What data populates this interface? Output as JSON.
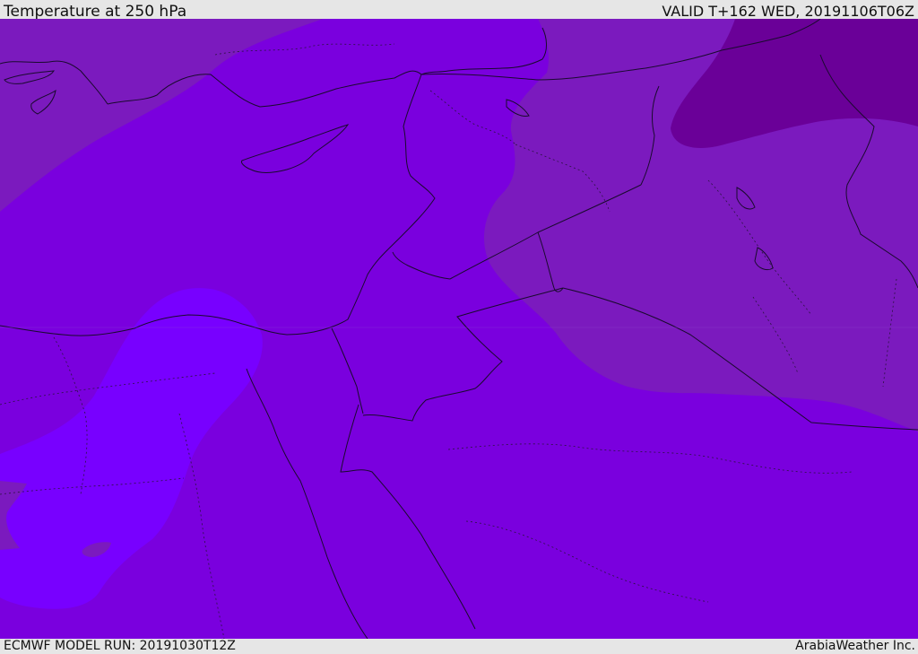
{
  "header": {
    "title": "Temperature at 250 hPa",
    "valid": "VALID T+162 WED, 20191106T06Z"
  },
  "footer": {
    "model_run": "ECMWF MODEL RUN: 20191030T12Z",
    "credit": "ArabiaWeather Inc."
  },
  "colors": {
    "base": "#7a00de",
    "cooler_band": "#7b1abe",
    "coldest": "#6a0098",
    "warm": "#7800ff",
    "coast": "#1a0a2e"
  }
}
